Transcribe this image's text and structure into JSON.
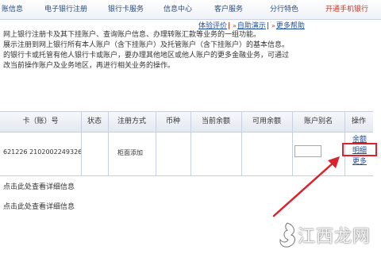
{
  "nav": {
    "items": [
      "账信息",
      "电子银行注册",
      "银行卡服务",
      "信息中心",
      "客户服务",
      "分行特色",
      "开通手机银行"
    ]
  },
  "actions": {
    "experience": "体验评价",
    "auto_demo": "自助演示",
    "more_help": "更多帮助"
  },
  "description": {
    "lines": [
      "网上银行注册卡及其下挂账户、查询账户信息、办理转账汇款等业务的一组功能。",
      "展示注册到网上银行所有本人账户（含下挂账户）及托管账户（含下挂账户）的基本信息。",
      "的银行卡或托管有他人银行卡或账户，要办理其他地区或他人账户的更多金融业务，可通过",
      "改当前操作账户及业务地区，再进行相关业务的操作。"
    ]
  },
  "table": {
    "headers": [
      "卡（账）号",
      "状态",
      "注册方式",
      "币种",
      "当前余额",
      "可用余额",
      "账户别名",
      "操作"
    ],
    "row": {
      "account": "621226 2102002249326",
      "status": "",
      "reg_method": "柜面添加",
      "currency": "",
      "balance": "",
      "available": "",
      "alias": ""
    },
    "ops": [
      "余额",
      "明细",
      "更多"
    ]
  },
  "footer": {
    "lines": [
      "点击此处查看详细信息",
      "点击此处查看详细信息"
    ]
  },
  "watermark": {
    "text": "江西龙网"
  },
  "colors": {
    "highlight": "#d9232e",
    "link": "#1f4e9c",
    "header_bg": "#e3e8f0"
  }
}
